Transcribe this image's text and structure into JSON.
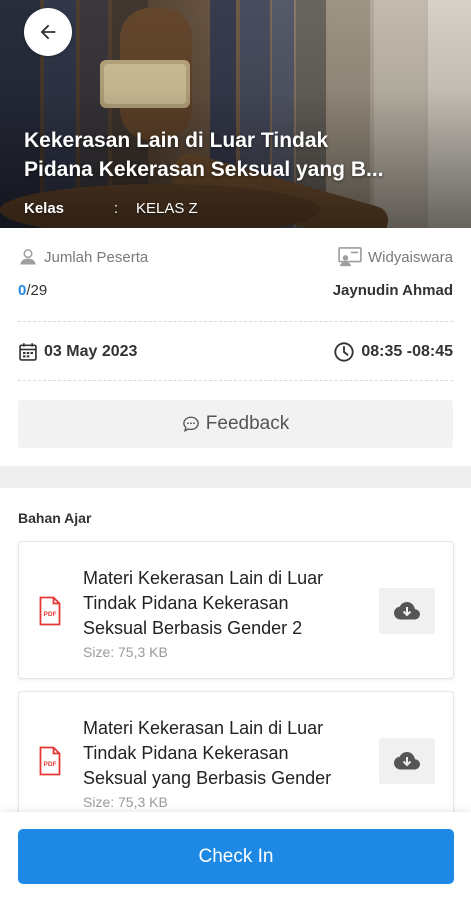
{
  "header": {
    "title_line1": "Kekerasan Lain di Luar Tindak",
    "title_line2": "Pidana Kekerasan Seksual yang B...",
    "class_label": "Kelas",
    "class_separator": ":",
    "class_value": "KELAS Z",
    "back_icon": "arrow-left-icon"
  },
  "info": {
    "participants_label": "Jumlah Peserta",
    "participants_current": "0",
    "participants_total": "/29",
    "trainer_label": "Widyaiswara",
    "trainer_name": "Jaynudin Ahmad",
    "date": "03 May 2023",
    "time": "08:35 -08:45",
    "feedback_label": "Feedback"
  },
  "materials": {
    "section_title": "Bahan Ajar",
    "items": [
      {
        "line1": "Materi Kekerasan Lain di Luar",
        "line2": "Tindak Pidana Kekerasan",
        "line3": "Seksual Berbasis Gender 2",
        "size": "Size: 75,3 KB"
      },
      {
        "line1": "Materi Kekerasan Lain di Luar",
        "line2": "Tindak Pidana Kekerasan",
        "line3": "Seksual yang Berbasis Gender",
        "size": "Size: 75,3 KB"
      }
    ]
  },
  "actions": {
    "checkin_label": "Check In"
  },
  "colors": {
    "primary": "#1e88e5",
    "pdf_red": "#e53935"
  }
}
